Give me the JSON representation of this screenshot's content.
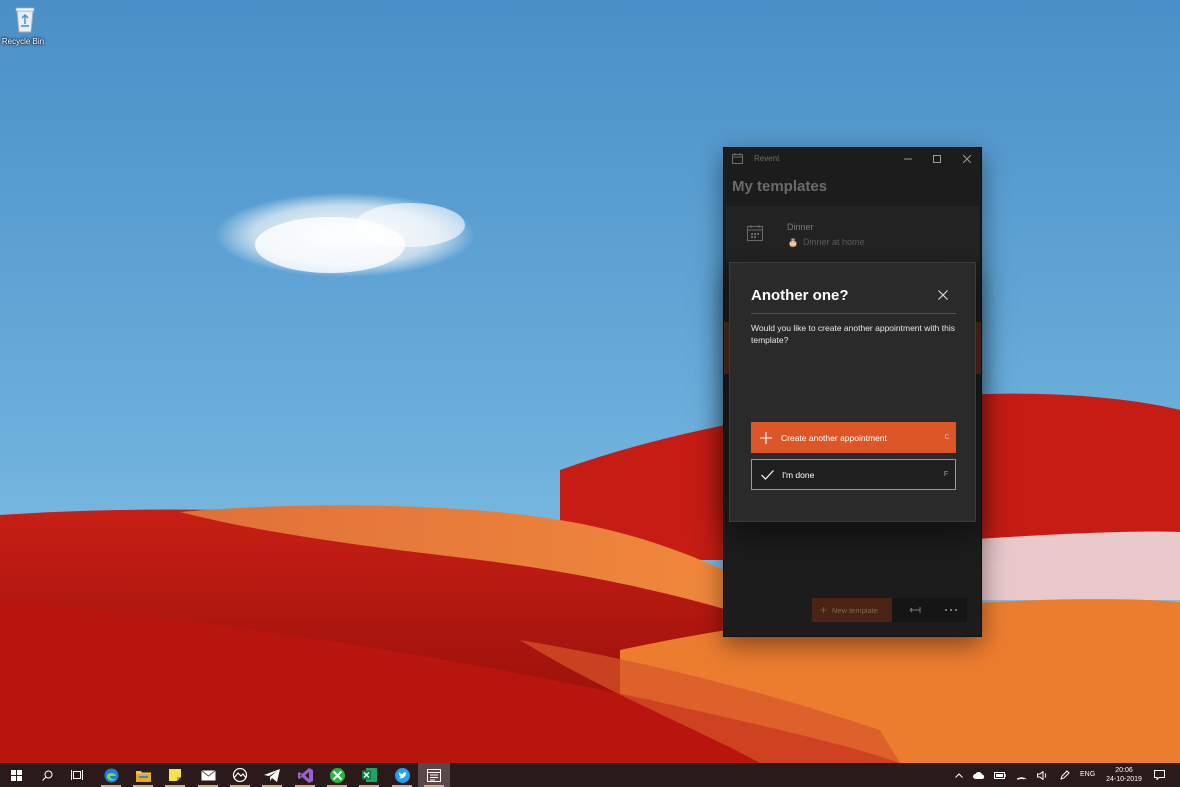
{
  "desktop": {
    "recycle_bin_label": "Recycle Bin"
  },
  "window": {
    "app_name": "Revent",
    "page_title": "My templates",
    "template": {
      "name": "Dinner",
      "subtitle": "Dinner at home",
      "emoji": "🎂"
    },
    "new_template_label": "New template",
    "new_template_icon": "plus-icon",
    "more_glyph": "···"
  },
  "dialog": {
    "title": "Another one?",
    "message": "Would you like to create another appointment with this template?",
    "create_label": "Create another appointment",
    "create_shortcut": "C",
    "done_label": "I'm done",
    "done_shortcut": "F"
  },
  "taskbar": {
    "apps": [
      "start-icon",
      "search-icon",
      "task-view-icon",
      "edge-icon",
      "file-explorer-icon",
      "sticky-notes-icon",
      "mail-icon",
      "xbox-like-icon",
      "telegram-icon",
      "visual-studio-icon",
      "xbox-icon",
      "excel-icon",
      "twitter-icon",
      "revent-icon"
    ],
    "language": "ENG",
    "time": "20:06",
    "date": "24-10-2019"
  },
  "colors": {
    "accent": "#dd5627",
    "window_bg": "#1c1c1c",
    "dialog_bg": "#2a2a2a",
    "taskbar_bg": "#2b1a1a"
  }
}
